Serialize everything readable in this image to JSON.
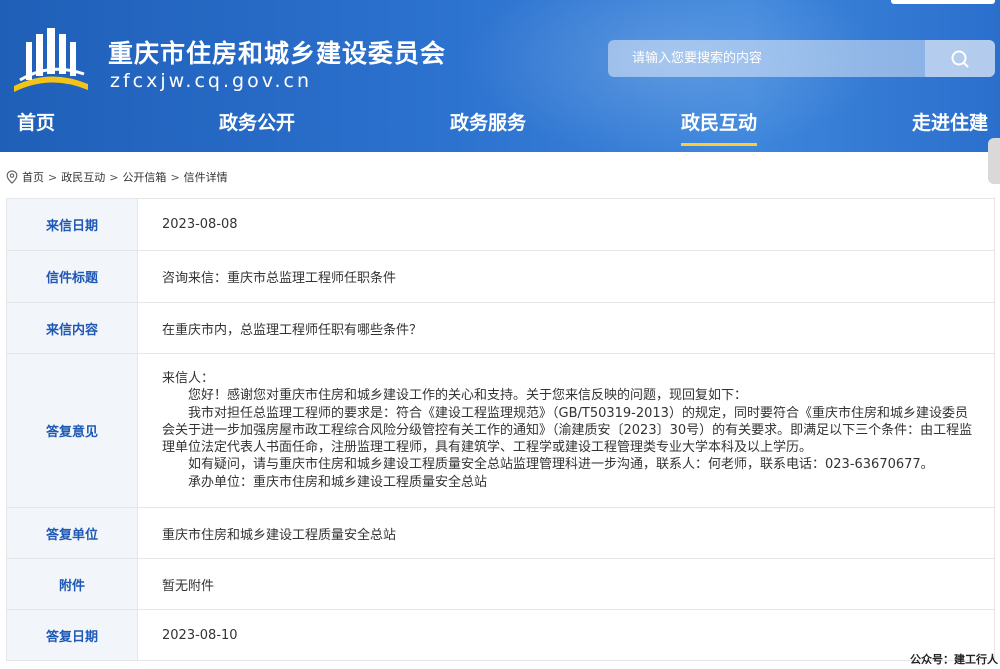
{
  "header": {
    "site_title": "重庆市住房和城乡建设委员会",
    "site_domain": "zfcxjw.cq.gov.cn",
    "search": {
      "placeholder": "请输入您要搜索的内容"
    },
    "icons": {
      "logo": "government-building-logo-icon",
      "search": "search-icon"
    }
  },
  "nav": {
    "items": [
      {
        "label": "首页"
      },
      {
        "label": "政务公开"
      },
      {
        "label": "政务服务"
      },
      {
        "label": "政民互动",
        "active": true
      },
      {
        "label": "走进住建"
      }
    ]
  },
  "breadcrumb": {
    "icon": "location-pin-icon",
    "items": [
      "首页",
      "政民互动",
      "公开信箱",
      "信件详情"
    ],
    "separator": ">"
  },
  "letter": {
    "date_label": "来信日期",
    "date": "2023-08-08",
    "subject_label": "信件标题",
    "subject": "咨询来信：重庆市总监理工程师任职条件",
    "content_label": "来信内容",
    "content": "在重庆市内，总监理工程师任职有哪些条件？",
    "reply_label": "答复意见",
    "reply": {
      "greeting": "来信人：",
      "line1": "您好！感谢您对重庆市住房和城乡建设工作的关心和支持。关于您来信反映的问题，现回复如下：",
      "line2": "我市对担任总监理工程师的要求是：符合《建设工程监理规范》（GB/T50319-2013）的规定，同时要符合《重庆市住房和城乡建设委员会关于进一步加强房屋市政工程综合风险分级管控有关工作的通知》（渝建质安〔2023〕30号）的有关要求。即满足以下三个条件：由工程监理单位法定代表人书面任命，注册监理工程师，具有建筑学、工程学或建设工程管理类专业大学本科及以上学历。",
      "line3": "如有疑问，请与重庆市住房和城乡建设工程质量安全总站监理管理科进一步沟通，联系人：何老师，联系电话：023-63670677。",
      "line4": "承办单位：重庆市住房和城乡建设工程质量安全总站"
    },
    "unit_label": "答复单位",
    "unit": "重庆市住房和城乡建设工程质量安全总站",
    "attachment_label": "附件",
    "attachment": "暂无附件",
    "reply_date_label": "答复日期",
    "reply_date": "2023-08-10"
  },
  "watermark": "公众号：建工行人",
  "colors": {
    "header_blue": "#2c72cf",
    "label_blue": "#1f58b5",
    "label_bg": "#f2f6fb",
    "nav_active_underline": "#ffcc33"
  }
}
